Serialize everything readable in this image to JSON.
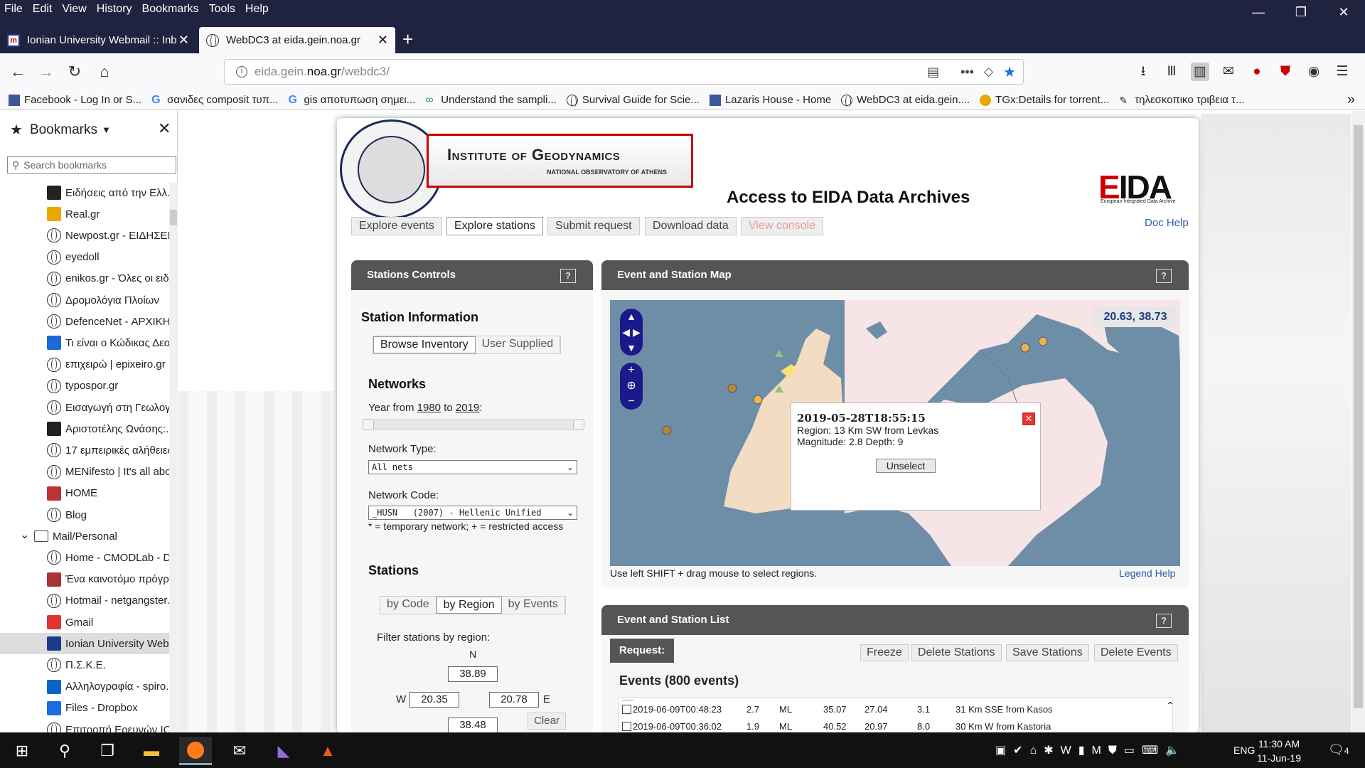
{
  "menu": [
    "File",
    "Edit",
    "View",
    "History",
    "Bookmarks",
    "Tools",
    "Help"
  ],
  "window_controls": [
    "—",
    "❐",
    "✕"
  ],
  "tabs": [
    {
      "title": "Ionian University Webmail :: Inb",
      "icon": "ionian-icon"
    },
    {
      "title": "WebDC3 at eida.gein.noa.gr",
      "icon": "globe-icon"
    }
  ],
  "url": {
    "pre": "eida.gein.",
    "host": "noa.gr",
    "path": "/webdc3/"
  },
  "bookmarks_toolbar": [
    {
      "label": "Facebook - Log In or S...",
      "icon": "facebook-icon",
      "color": "#3b5998"
    },
    {
      "label": "σανιδες composit τυπ...",
      "icon": "google-icon",
      "color": "#4285f4"
    },
    {
      "label": "gis αποτυπωση σημει...",
      "icon": "google-icon",
      "color": "#4285f4"
    },
    {
      "label": "Understand the sampli...",
      "icon": "infinity-icon",
      "color": "#1a5"
    },
    {
      "label": "Survival Guide for Scie...",
      "icon": "globe-icon",
      "color": "#333"
    },
    {
      "label": "Lazaris House - Home",
      "icon": "facebook-icon",
      "color": "#3b5998"
    },
    {
      "label": "WebDC3 at eida.gein....",
      "icon": "globe-icon",
      "color": "#333"
    },
    {
      "label": "TGx:Details for torrent...",
      "icon": "tgx-icon",
      "color": "#e8a800"
    },
    {
      "label": "τηλεσκοπικο τριβεια τ...",
      "icon": "tool-icon",
      "color": "#333"
    }
  ],
  "sidebar": {
    "title": "Bookmarks",
    "search_placeholder": "Search bookmarks",
    "items": [
      {
        "label": "Ειδήσεις από την Ελλ...",
        "icon": "news247-icon",
        "indent": 1
      },
      {
        "label": "Real.gr",
        "icon": "real-icon",
        "indent": 1
      },
      {
        "label": "Newpost.gr - ΕΙΔΗΣΕΙ...",
        "icon": "globe-icon",
        "indent": 1
      },
      {
        "label": "eyedoll",
        "icon": "globe-icon",
        "indent": 1
      },
      {
        "label": "enikos.gr - Όλες οι ειδ...",
        "icon": "globe-icon",
        "indent": 1
      },
      {
        "label": "Δρομολόγια Πλοίων",
        "icon": "globe-icon",
        "indent": 1
      },
      {
        "label": "DefenceNet - ΑΡΧΙΚΗ",
        "icon": "globe-icon",
        "indent": 1
      },
      {
        "label": "Τι είναι ο Κώδικας Δεο...",
        "icon": "c-icon",
        "indent": 1
      },
      {
        "label": "επιχειρώ | epixeiro.gr",
        "icon": "globe-icon",
        "indent": 1
      },
      {
        "label": "typospor.gr",
        "icon": "globe-icon",
        "indent": 1
      },
      {
        "label": "Εισαγωγή στη Γεωλογ...",
        "icon": "globe-icon",
        "indent": 1
      },
      {
        "label": "Αριστοτέλης Ωνάσης:...",
        "icon": "news247-icon",
        "indent": 1
      },
      {
        "label": "17 εμπειρικές αλήθειες...",
        "icon": "globe-icon",
        "indent": 1
      },
      {
        "label": "MENifesto | It's all abo...",
        "icon": "globe-icon",
        "indent": 1
      },
      {
        "label": "HOME",
        "icon": "home-icon",
        "indent": 1
      },
      {
        "label": "Blog",
        "icon": "globe-icon",
        "indent": 1
      },
      {
        "label": "Mail/Personal",
        "icon": "folder-icon",
        "indent": 0
      },
      {
        "label": "Home - CMODLab - D...",
        "icon": "globe-icon",
        "indent": 1
      },
      {
        "label": "Ένα καινοτόμο πρόγρ...",
        "icon": "bird-icon",
        "indent": 1
      },
      {
        "label": "Hotmail - netgangster...",
        "icon": "globe-icon",
        "indent": 1
      },
      {
        "label": "Gmail",
        "icon": "gmail-icon",
        "indent": 1
      },
      {
        "label": "Ionian University Web...",
        "icon": "ionian-icon",
        "indent": 1
      },
      {
        "label": "Π.Σ.Κ.Ε.",
        "icon": "globe-icon",
        "indent": 1
      },
      {
        "label": "Αλληλογραφία - spiro...",
        "icon": "outlook-icon",
        "indent": 1
      },
      {
        "label": "Files - Dropbox",
        "icon": "dropbox-icon",
        "indent": 1
      },
      {
        "label": "Επιτροπή Ερευνών ΙΟ...",
        "icon": "globe-icon",
        "indent": 1
      }
    ]
  },
  "header": {
    "institute_name": "Institute of Geodynamics",
    "institute_sub": "NATIONAL OBSERVATORY OF ATHENS",
    "title": "Access to EIDA Data Archives",
    "eida_logo": "EIDA",
    "eida_sub": "European Integrated Data Archive",
    "doc_help": "Doc Help",
    "tabs": [
      "Explore events",
      "Explore stations",
      "Submit request",
      "Download data",
      "View console"
    ]
  },
  "controls": {
    "title": "Stations Controls",
    "help": "?",
    "station_info": "Station Information",
    "inventory_tabs": [
      "Browse Inventory",
      "User Supplied"
    ],
    "networks": "Networks",
    "year_prefix": "Year from ",
    "year_from": "1980",
    "year_mid": " to ",
    "year_to": "2019",
    "year_suffix": ":",
    "network_type_label": "Network Type:",
    "network_type_value": "All nets",
    "network_code_label": "Network Code:",
    "network_code_value": "_HUSN   (2007) - Hellenic Unified",
    "note": "* = temporary network; + = restricted access",
    "stations": "Stations",
    "station_tabs": [
      "by Code",
      "by Region",
      "by Events"
    ],
    "filter_label": "Filter stations by region:",
    "N": "N",
    "W": "W",
    "E": "E",
    "north": "38.89",
    "west": "20.35",
    "east": "20.78",
    "south": "38.48",
    "clear": "Clear"
  },
  "map": {
    "title": "Event and Station Map",
    "help": "?",
    "coords": "20.63, 38.73",
    "popup_time": "2019-05-28T18:55:15",
    "popup_region": "Region: 13 Km SW from Levkas",
    "popup_mag": "Magnitude: 2.8 Depth: 9",
    "unselect": "Unselect",
    "hint": "Use left SHIFT + drag mouse to select regions.",
    "legend_help": "Legend Help"
  },
  "list": {
    "title": "Event and Station List",
    "help": "?",
    "request": "Request:",
    "buttons": [
      "Freeze",
      "Delete Stations",
      "Save Stations",
      "Delete Events"
    ],
    "events_header": "Events (800 events)",
    "rows": [
      [
        "2019-06-09T00:48:23",
        "2.7",
        "ML",
        "35.07",
        "27.04",
        "3.1",
        "31 Km SSE from Kasos"
      ],
      [
        "2019-06-09T00:36:02",
        "1.9",
        "ML",
        "40.52",
        "20.97",
        "8.0",
        "30 Km W from Kastoria"
      ]
    ]
  },
  "taskbar": {
    "lang": "ENG",
    "time": "11:30 AM",
    "date": "11-Jun-19",
    "notif": "4"
  }
}
